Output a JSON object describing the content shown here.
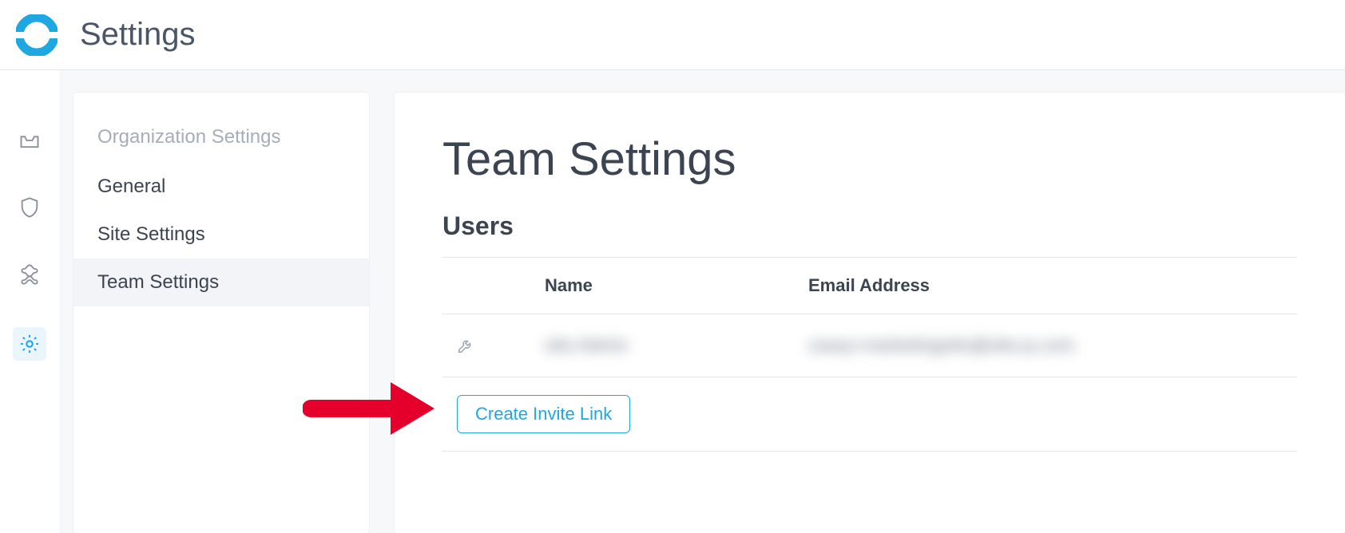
{
  "header": {
    "title": "Settings"
  },
  "iconRail": {
    "items": [
      {
        "name": "inbox-icon",
        "active": false
      },
      {
        "name": "shield-icon",
        "active": false
      },
      {
        "name": "integration-icon",
        "active": false
      },
      {
        "name": "gear-icon",
        "active": true
      }
    ]
  },
  "sidebar": {
    "heading": "Organization Settings",
    "items": [
      {
        "label": "General",
        "active": false
      },
      {
        "label": "Site Settings",
        "active": false
      },
      {
        "label": "Team Settings",
        "active": true
      }
    ]
  },
  "main": {
    "title": "Team Settings",
    "usersSection": {
      "heading": "Users",
      "columns": {
        "name": "Name",
        "email": "Email Address"
      },
      "rows": [
        {
          "name": "otto Admin",
          "email": "casey+marketingotto@otto-js.com"
        }
      ],
      "inviteButton": "Create Invite Link"
    }
  },
  "colors": {
    "accent": "#1ea7e0",
    "annotation": "#e4002b"
  }
}
